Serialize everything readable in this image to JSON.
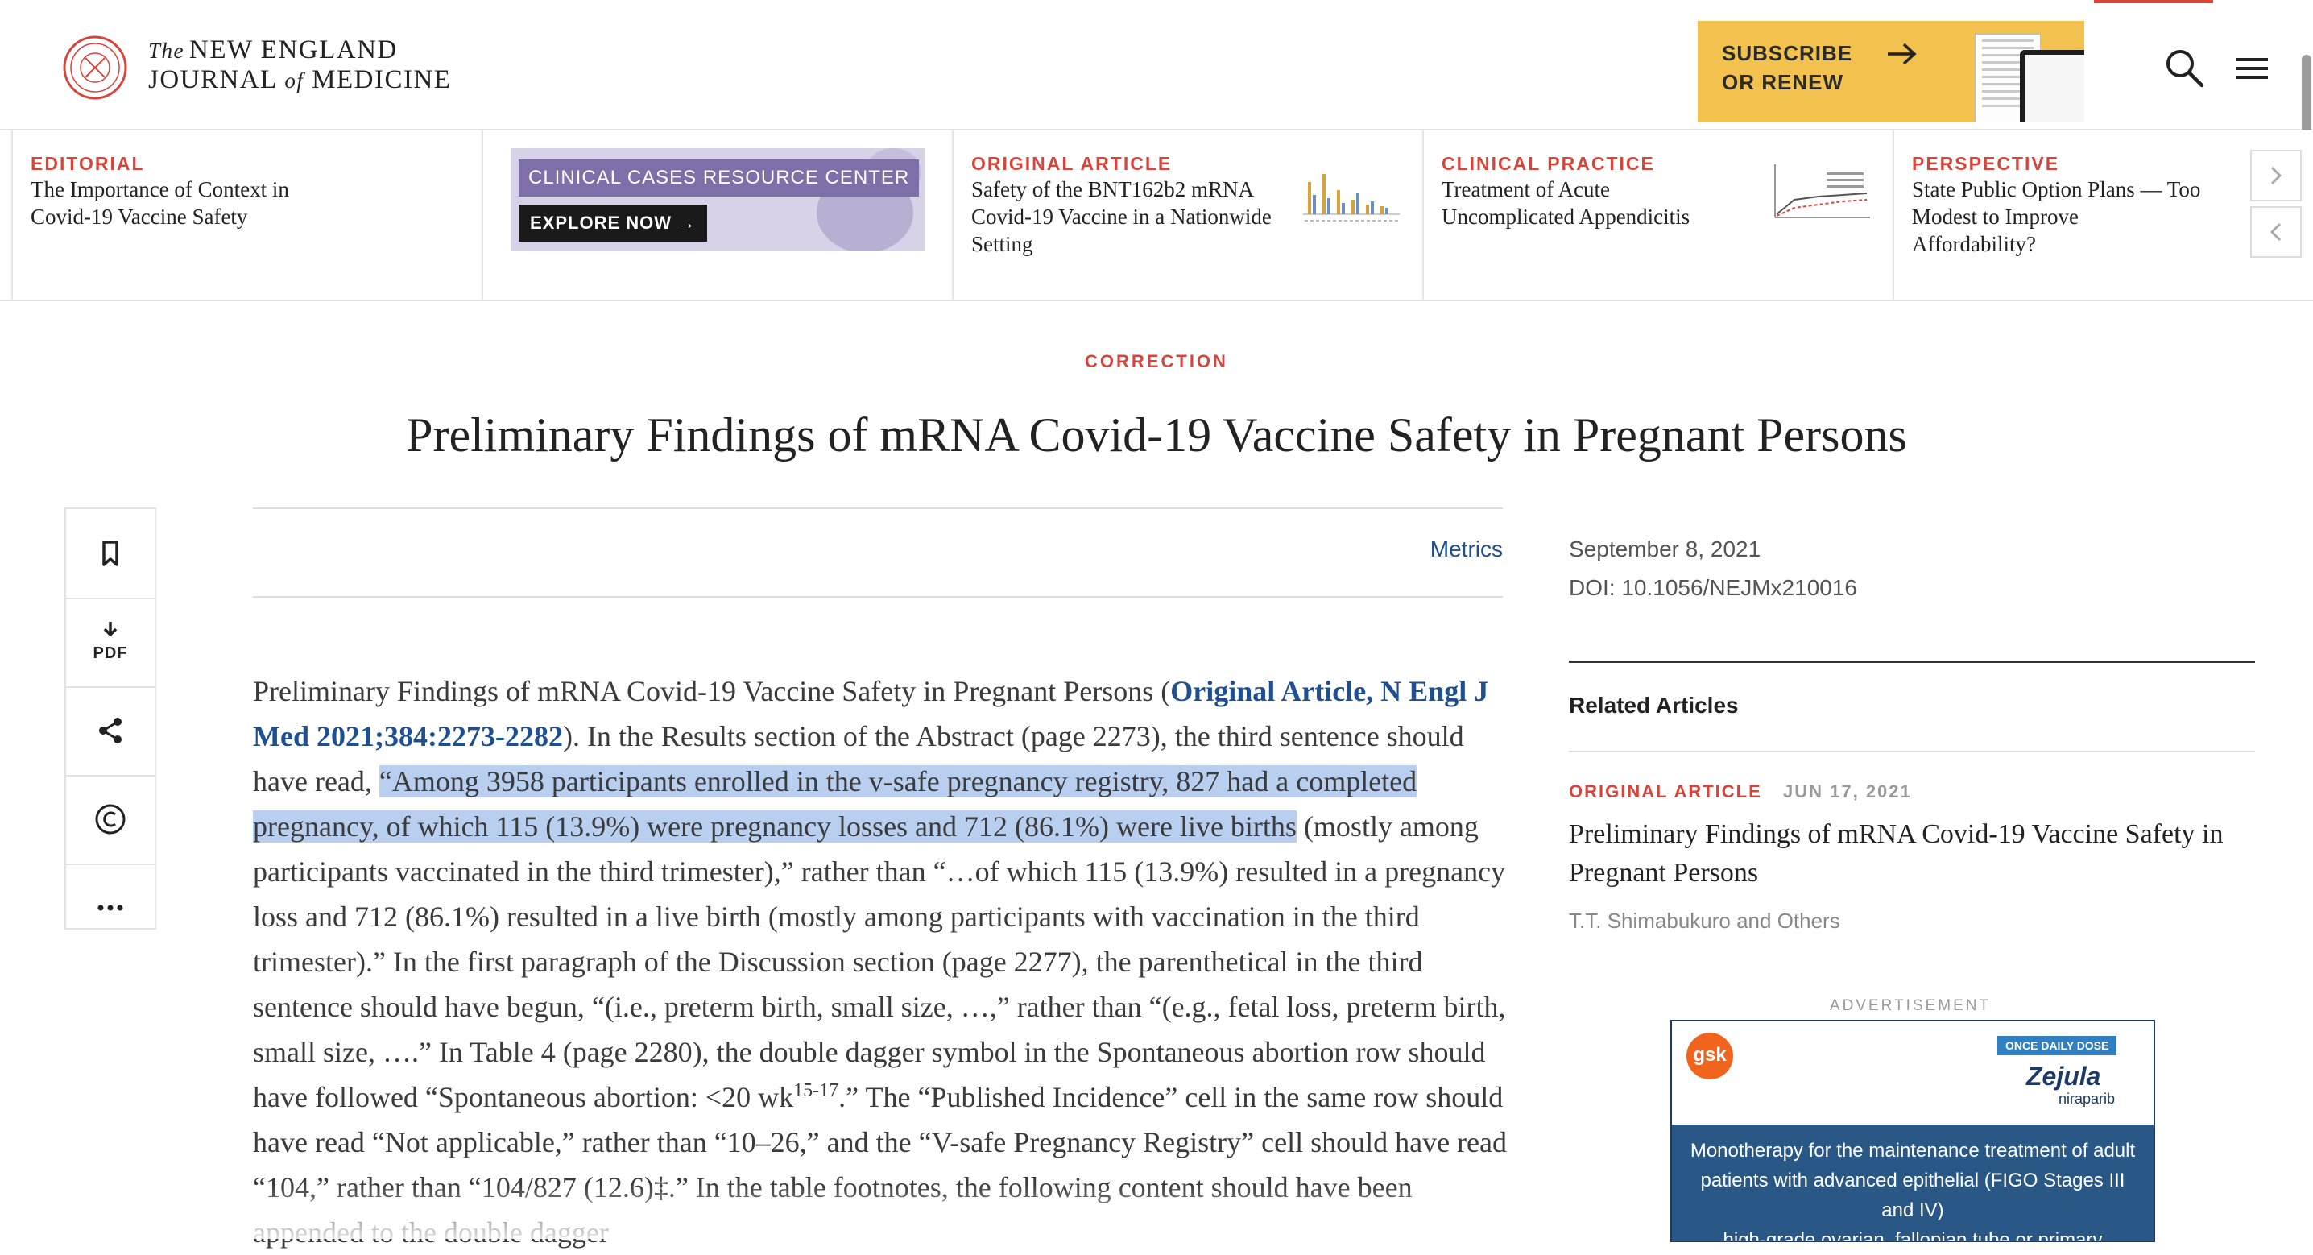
{
  "header": {
    "logo": {
      "the": "The",
      "line1": "NEW ENGLAND",
      "journal": "JOURNAL",
      "of": "of",
      "medicine": "MEDICINE"
    },
    "subscribe": {
      "line1": "SUBSCRIBE",
      "line2": "OR RENEW"
    },
    "icons": {
      "search": "search-icon",
      "menu": "hamburger-menu-icon",
      "seal": "nejm-seal-icon"
    }
  },
  "carousel": {
    "cards": [
      {
        "category": "EDITORIAL",
        "title_lines": [
          "The Importance of Context in",
          "Covid-19 Vaccine Safety"
        ]
      },
      {
        "banner_line1": "CLINICAL CASES RESOURCE CENTER",
        "banner_line2": "EXPLORE NOW"
      },
      {
        "category": "ORIGINAL ARTICLE",
        "title_lines": [
          "Safety of the BNT162b2 mRNA",
          "Covid-19 Vaccine in a Nationwide",
          "Setting"
        ]
      },
      {
        "category": "CLINICAL PRACTICE",
        "title_lines": [
          "Treatment of Acute",
          "Uncomplicated Appendicitis"
        ]
      },
      {
        "category": "PERSPECTIVE",
        "title_lines": [
          "State Public Option Plans — Too",
          "Modest to Improve",
          "Affordability?"
        ]
      }
    ]
  },
  "article": {
    "type": "CORRECTION",
    "title": "Preliminary Findings of mRNA Covid-19 Vaccine Safety in Pregnant Persons",
    "metrics_label": "Metrics",
    "body": {
      "t1": "Preliminary Findings of mRNA Covid-19 Vaccine Safety in Pregnant Persons (",
      "link": "Original Article, N Engl J Med 2021;384:2273-2282",
      "t2": "). In the Results section of the Abstract (page 2273), the third sentence should have read, ",
      "highlight": "“Among 3958 participants enrolled in the v-safe pregnancy registry, 827 had a completed pregnancy, of which 115 (13.9%) were pregnancy losses and 712 (86.1%) were live births",
      "t3": " (mostly among participants vaccinated in the third trimester),” rather than “…of which 115 (13.9%) resulted in a pregnancy loss and 712 (86.1%) resulted in a live birth (mostly among participants with vaccination in the third trimester).” In the first paragraph of the Discussion section (page 2277), the parenthetical in the third sentence should have begun, “(i.e., preterm birth, small size, …,” rather than “(e.g., fetal loss, preterm birth, small size, ….” In Table 4 (page 2280), the double dagger symbol in the Spontaneous abortion row should have followed “Spontaneous abortion: <20 wk",
      "sup1": "15-17",
      "t4": ".” The “Published Incidence” cell in the same row should have read “Not applicable,” rather than “10–26,” and the “V-safe Pregnancy Registry” cell should have read “104,” rather than “104/827 (12.6)‡.” In the table footnotes, the following content should have been appended to the double dagger"
    },
    "tools": [
      "bookmark-icon",
      "pdf-download-icon",
      "share-icon",
      "copyright-icon",
      "more-icon"
    ],
    "pdf_label": "PDF"
  },
  "sidebar": {
    "date": "September 8, 2021",
    "doi": "DOI: 10.1056/NEJMx210016",
    "related_heading": "Related Articles",
    "related": {
      "category": "ORIGINAL ARTICLE",
      "date": "JUN 17, 2021",
      "title": "Preliminary Findings of mRNA Covid-19 Vaccine Safety in Pregnant Persons",
      "authors": "T.T. Shimabukuro and Others"
    }
  },
  "advertisement": {
    "label": "ADVERTISEMENT",
    "company": "gsk",
    "dose_badge": "ONCE DAILY DOSE",
    "brand": "Zejula",
    "generic": "niraparib",
    "copy_lines": [
      "Monotherapy for the maintenance treatment of adult",
      "patients with advanced epithelial (FIGO Stages III and IV)",
      "high-grade ovarian, fallopian tube or primary peritoneal"
    ]
  },
  "colors": {
    "accent": "#d9443a",
    "link": "#1d4f91",
    "subscribe_bg": "#f2c14e",
    "highlight": "#b9cff0"
  }
}
